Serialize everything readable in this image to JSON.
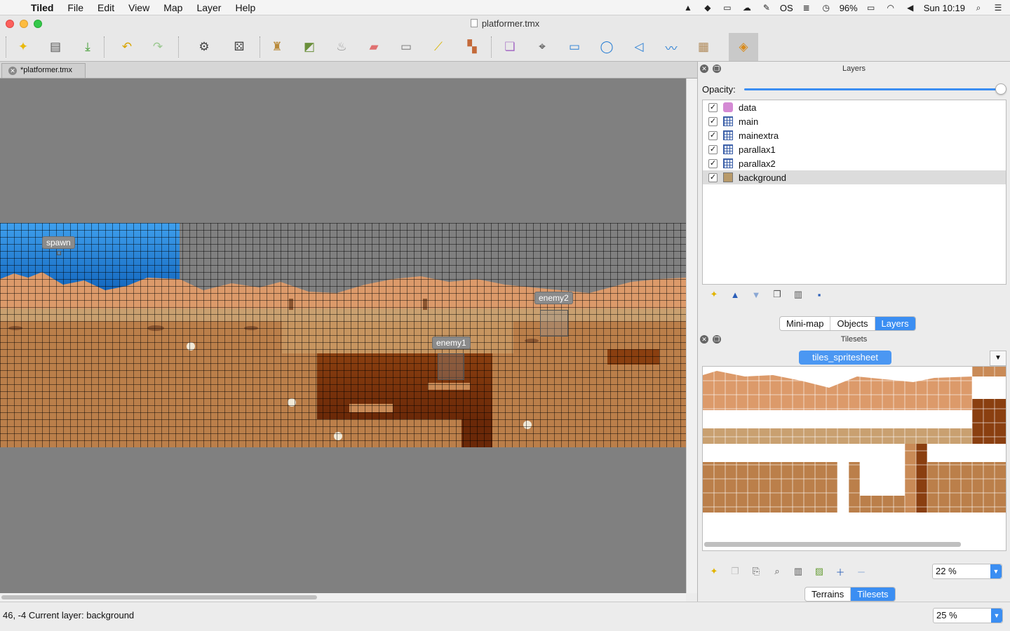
{
  "menubar": {
    "app_name": "Tiled",
    "items": [
      "File",
      "Edit",
      "View",
      "Map",
      "Layer",
      "Help"
    ],
    "battery": "96%",
    "clock": "Sun 10:19",
    "os_label": "OS"
  },
  "window": {
    "title": "platformer.tmx"
  },
  "document_tab": {
    "label": "*platformer.tmx"
  },
  "map_objects": {
    "spawn": "spawn",
    "enemy1": "enemy1",
    "enemy2": "enemy2"
  },
  "layers_panel": {
    "title": "Layers",
    "opacity_label": "Opacity:",
    "opacity_value": 1.0,
    "layers": [
      {
        "name": "data",
        "type": "object",
        "visible": true
      },
      {
        "name": "main",
        "type": "tile",
        "visible": true
      },
      {
        "name": "mainextra",
        "type": "tile",
        "visible": true
      },
      {
        "name": "parallax1",
        "type": "tile",
        "visible": true
      },
      {
        "name": "parallax2",
        "type": "tile",
        "visible": true
      },
      {
        "name": "background",
        "type": "image",
        "visible": true,
        "selected": true
      }
    ],
    "tabs": [
      "Mini-map",
      "Objects",
      "Layers"
    ],
    "active_tab": "Layers"
  },
  "tilesets_panel": {
    "title": "Tilesets",
    "tileset_name": "tiles_spritesheet",
    "zoom": "22 %",
    "tabs": [
      "Terrains",
      "Tilesets"
    ],
    "active_tab": "Tilesets"
  },
  "status": {
    "text": "46, -4  Current layer: background",
    "zoom": "25 %"
  },
  "colors": {
    "accent": "#3b8ef2",
    "sky": "#1a7fd8",
    "sand": "#cf9c6b",
    "dirt": "#b97e48",
    "pit": "#6e2e0c"
  }
}
